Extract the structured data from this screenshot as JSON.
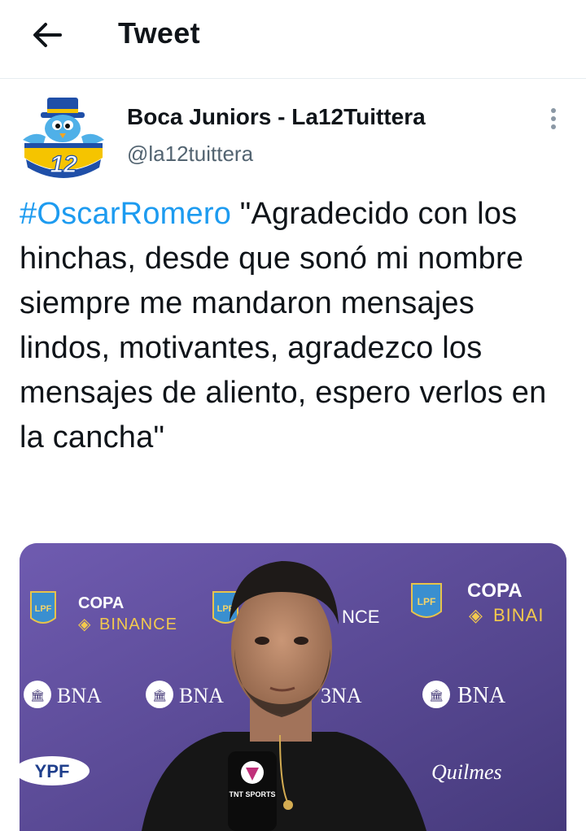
{
  "header": {
    "title": "Tweet",
    "back_icon": "arrow-left-icon"
  },
  "author": {
    "display_name": "Boca Juniors - La12Tuittera",
    "handle": "@la12tuittera",
    "avatar_number": "12",
    "more_icon": "more-vertical-icon"
  },
  "tweet": {
    "hashtag": "#OscarRomero",
    "text": " \"Agradecido con los hinchas, desde que sonó mi nombre siempre me mandaron mensajes lindos, motivantes, agradezco los mensajes de aliento, espero verlos en la cancha\""
  },
  "media": {
    "backdrop": {
      "copa": "COPA",
      "binance": "BINANCE",
      "binance_partial": "BINAI",
      "nce": "NCE",
      "lpf": "LPF",
      "bna": "BNA",
      "bna_partial": "3NA",
      "ypf": "YPF",
      "quilmes": "Quilmes"
    },
    "microphone_label": "TNT SPORTS"
  },
  "colors": {
    "accent": "#1d9bf0",
    "text": "#0f1419",
    "secondary": "#536471",
    "backdrop": "#6a5aa0"
  }
}
